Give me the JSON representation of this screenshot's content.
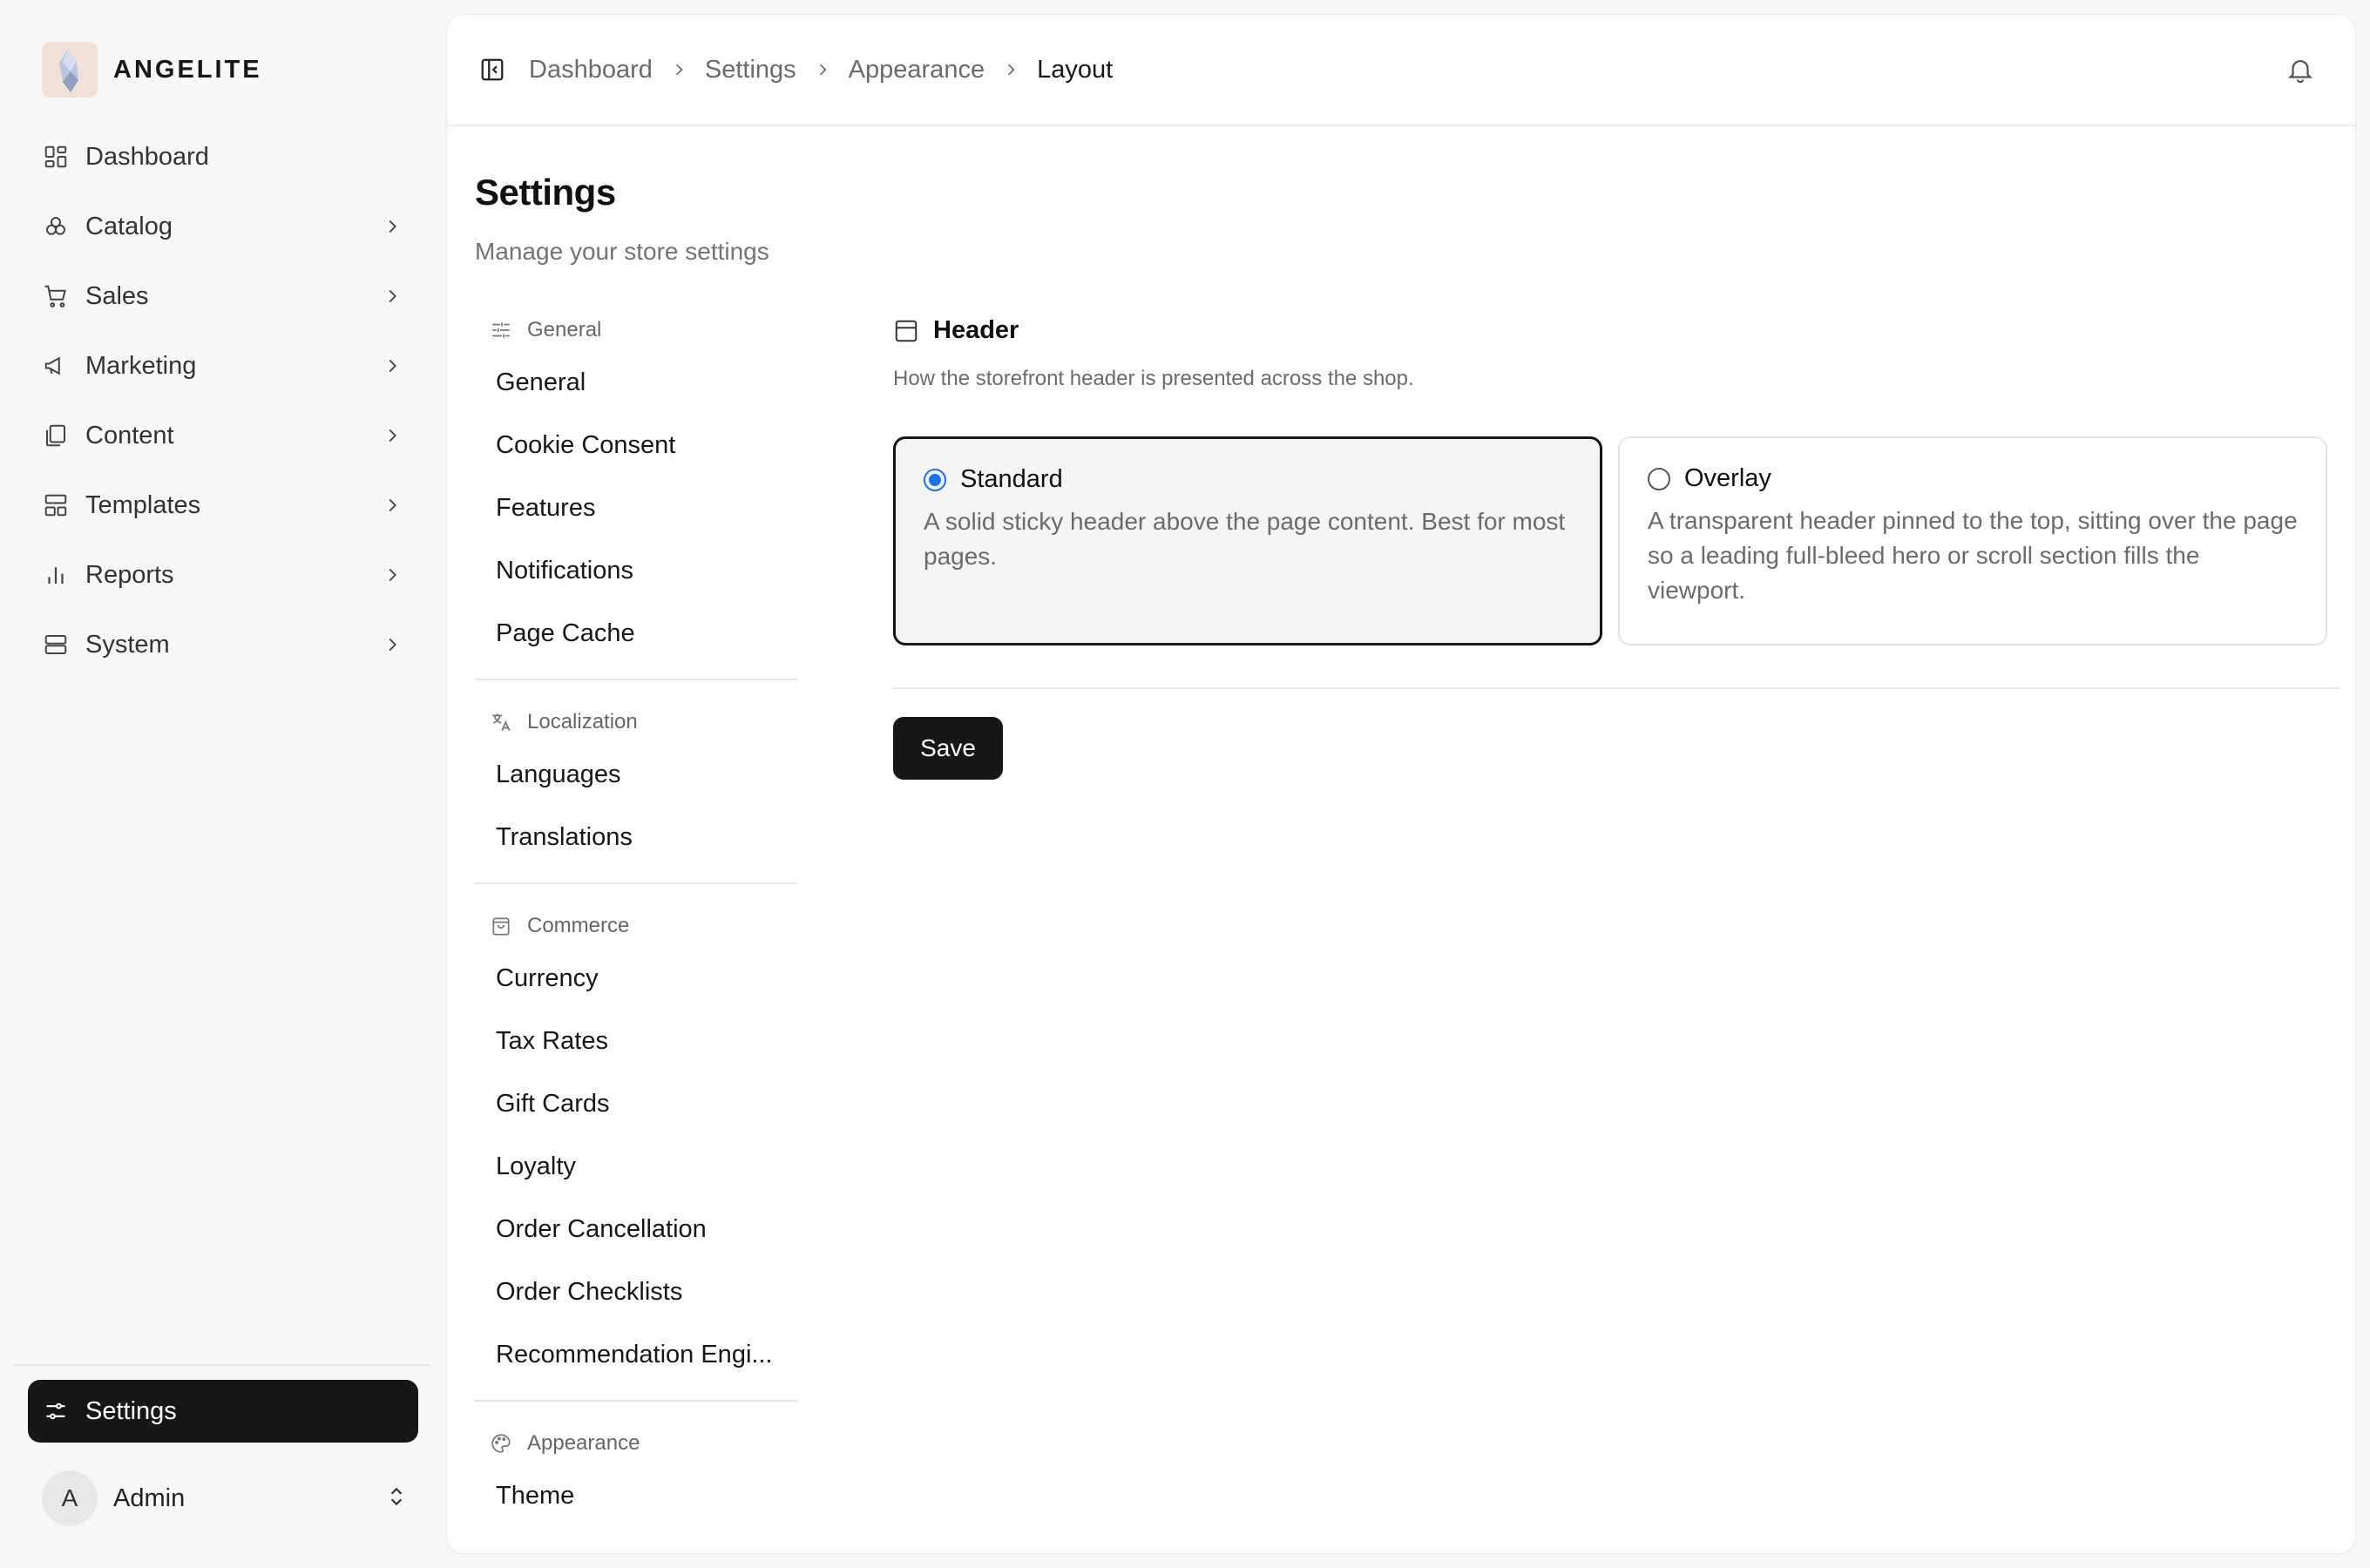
{
  "brand": {
    "name": "ANGELITE"
  },
  "sidebar": {
    "items": [
      {
        "label": "Dashboard",
        "icon": "dashboard-icon",
        "has_children": false
      },
      {
        "label": "Catalog",
        "icon": "catalog-icon",
        "has_children": true
      },
      {
        "label": "Sales",
        "icon": "cart-icon",
        "has_children": true
      },
      {
        "label": "Marketing",
        "icon": "megaphone-icon",
        "has_children": true
      },
      {
        "label": "Content",
        "icon": "pages-icon",
        "has_children": true
      },
      {
        "label": "Templates",
        "icon": "templates-icon",
        "has_children": true
      },
      {
        "label": "Reports",
        "icon": "bar-chart-icon",
        "has_children": true
      },
      {
        "label": "System",
        "icon": "server-icon",
        "has_children": true
      }
    ],
    "active": {
      "label": "Settings",
      "icon": "settings-sliders-icon"
    },
    "user": {
      "initial": "A",
      "name": "Admin"
    }
  },
  "breadcrumb": [
    "Dashboard",
    "Settings",
    "Appearance",
    "Layout"
  ],
  "page": {
    "title": "Settings",
    "subtitle": "Manage your store settings"
  },
  "subnav": {
    "groups": [
      {
        "label": "General",
        "icon": "sliders-icon",
        "items": [
          "General",
          "Cookie Consent",
          "Features",
          "Notifications",
          "Page Cache"
        ]
      },
      {
        "label": "Localization",
        "icon": "translate-icon",
        "items": [
          "Languages",
          "Translations"
        ]
      },
      {
        "label": "Commerce",
        "icon": "shopping-bag-icon",
        "items": [
          "Currency",
          "Tax Rates",
          "Gift Cards",
          "Loyalty",
          "Order Cancellation",
          "Order Checklists",
          "Recommendation Engi..."
        ]
      },
      {
        "label": "Appearance",
        "icon": "palette-icon",
        "items": [
          "Theme"
        ]
      }
    ]
  },
  "section": {
    "title": "Header",
    "description": "How the storefront header is presented across the shop.",
    "options": [
      {
        "title": "Standard",
        "description": "A solid sticky header above the page content. Best for most pages.",
        "selected": true
      },
      {
        "title": "Overlay",
        "description": "A transparent header pinned to the top, sitting over the page so a leading full-bleed hero or scroll section fills the viewport.",
        "selected": false
      }
    ]
  },
  "actions": {
    "save_label": "Save"
  },
  "colors": {
    "primary": "#171717",
    "radio_accent": "#1a73e8",
    "muted_text": "#6b6b6b"
  }
}
